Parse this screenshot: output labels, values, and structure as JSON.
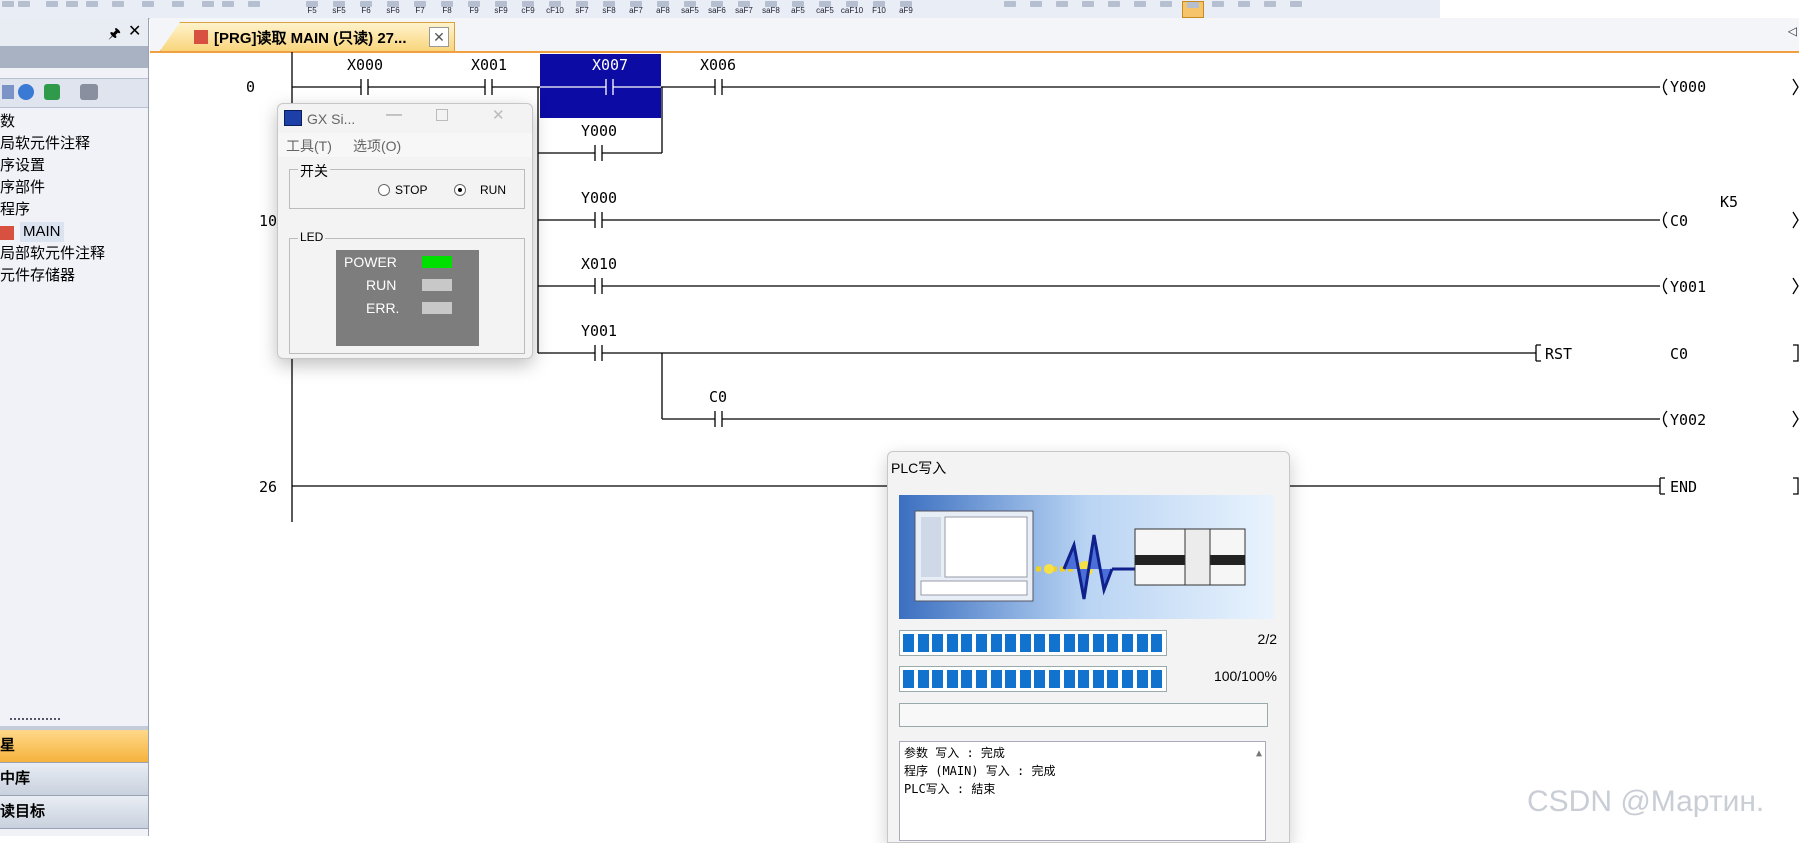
{
  "toolbar": {
    "fkeys": [
      "F5",
      "sF5",
      "F6",
      "sF6",
      "F7",
      "F8",
      "F9",
      "sF9",
      "cF9",
      "cF10",
      "sF7",
      "sF8",
      "aF7",
      "aF8",
      "saF5",
      "saF6",
      "saF7",
      "saF8",
      "aF5",
      "caF5",
      "caF10",
      "F10",
      "aF9"
    ]
  },
  "tree": {
    "items": [
      "数",
      "局软元件注释",
      "序设置",
      "序部件",
      "程序",
      "MAIN",
      "局部软元件注释",
      "元件存储器"
    ]
  },
  "bottom_tabs": [
    "星",
    "中库",
    "读目标"
  ],
  "doc_tab": {
    "label": "[PRG]读取 MAIN (只读) 27..."
  },
  "ladder": {
    "step0": "0",
    "step10": "10",
    "step26": "26",
    "contacts": {
      "x000": "X000",
      "x001": "X001",
      "x007": "X007",
      "x006": "X006",
      "y000a": "Y000",
      "y000b": "Y000",
      "x010": "X010",
      "y001": "Y001",
      "c0": "C0"
    },
    "coils": {
      "y000": "Y000",
      "c0": "C0",
      "k5": "K5",
      "y001": "Y001",
      "rst": "RST",
      "rst_c0": "C0",
      "y002": "Y002",
      "end": "END"
    }
  },
  "gx_simulator": {
    "title": "GX Si...",
    "menu_tools": "工具(T)",
    "menu_options": "选项(O)",
    "switch_group": "开关",
    "stop_label": "STOP",
    "run_label": "RUN",
    "selected": "RUN",
    "led_group": "LED",
    "led_power": "POWER",
    "led_run": "RUN",
    "led_err": "ERR.",
    "led_colors": {
      "power": "#00e000",
      "run": "#c8c8c8",
      "err": "#c8c8c8"
    }
  },
  "plc_write": {
    "title": "PLC写入",
    "progress1_text": "2/2",
    "progress2_text": "100/100%",
    "progress1": 1.0,
    "progress2": 1.0,
    "log": [
      "参数 写入 : 完成",
      "程序 (MAIN) 写入 : 完成",
      "PLC写入 : 結束"
    ]
  },
  "watermark": "CSDN @Мартин."
}
